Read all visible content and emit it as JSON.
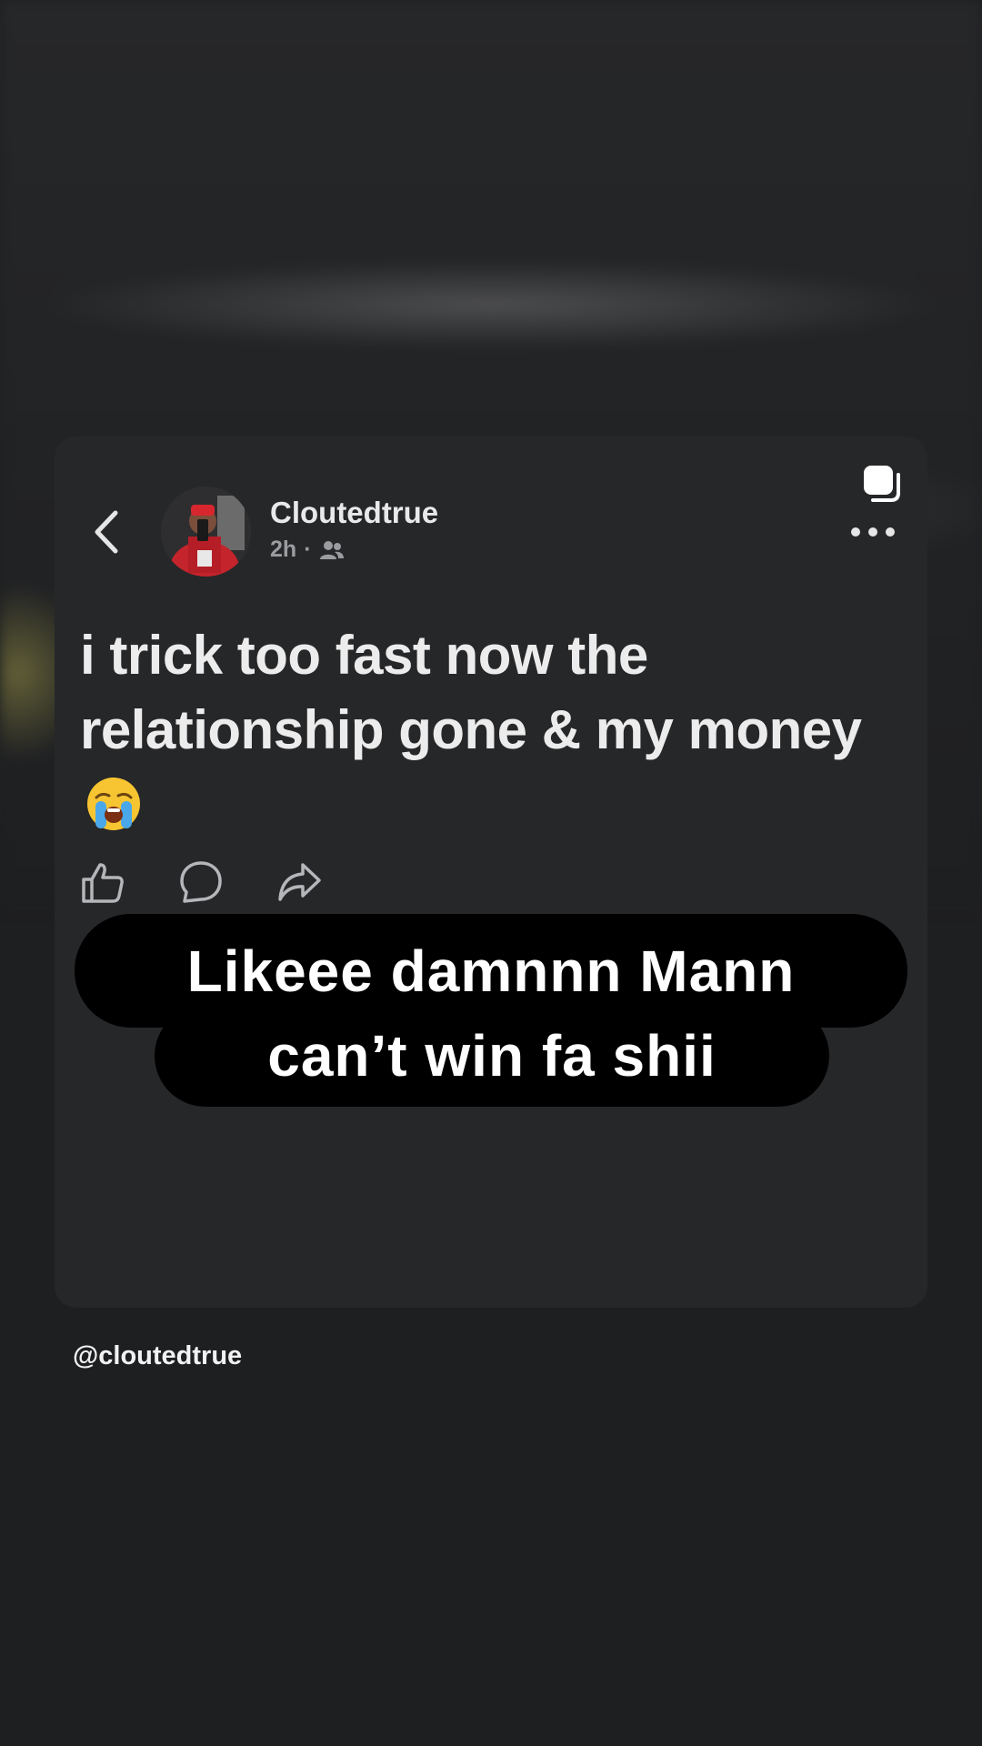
{
  "post": {
    "username": "Cloutedtrue",
    "time": "2h",
    "separator": "·",
    "text": "i trick too fast now the relationship gone & my money",
    "emoji": "loudly-crying-face",
    "audience_icon": "friends-icon"
  },
  "caption": {
    "line1": "Likeee damnnn Mann",
    "line2": "can’t win fa shii"
  },
  "footer": {
    "handle": "@cloutedtrue"
  },
  "icons": {
    "back": "chevron-left-icon",
    "copy": "copy-icon",
    "more": "more-horizontal-icon",
    "like": "thumbs-up-icon",
    "comment": "comment-icon",
    "share": "share-icon"
  },
  "colors": {
    "background": "#1e1f21",
    "card": "#262729",
    "caption_bg": "#000000",
    "secondary_text": "#9b9c9f"
  }
}
